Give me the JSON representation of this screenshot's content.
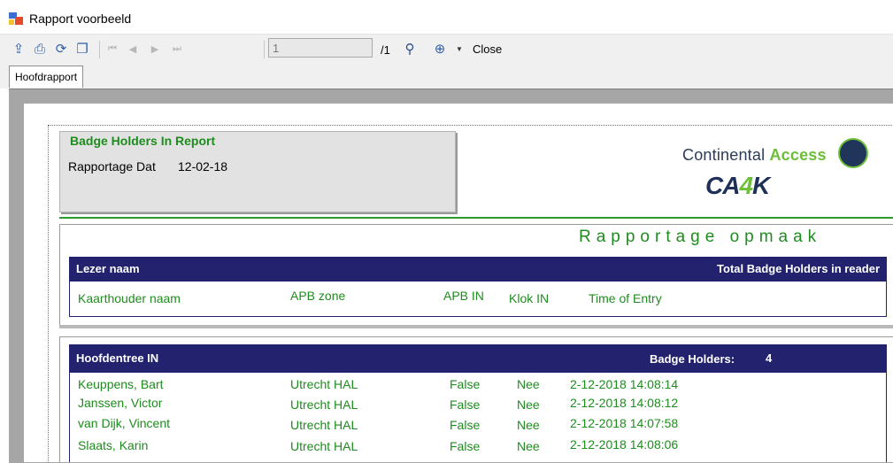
{
  "window": {
    "title": "Rapport voorbeeld"
  },
  "toolbar": {
    "export_icon": "export-icon",
    "print_icon": "print-icon",
    "refresh_icon": "refresh-icon",
    "copy_icon": "copy-icon",
    "first_icon": "first-page-icon",
    "prev_icon": "prev-page-icon",
    "next_icon": "next-page-icon",
    "last_icon": "last-page-icon",
    "page_value": "1",
    "page_total": "/1",
    "search_icon": "binoculars-icon",
    "zoom_icon": "zoom-icon",
    "close_label": "Close"
  },
  "tabs": [
    {
      "label": "Hoofdrapport"
    }
  ],
  "report": {
    "title": "Badge Holders In Report",
    "date_label": "Rapportage Dat",
    "date_value": "12-02-18",
    "logo_text": "Continental",
    "logo_accent": "Access",
    "logo_ca": "CA",
    "logo_4": "4",
    "logo_k": "K",
    "section_title": "Rapportage opmaak",
    "layout_header": {
      "left": "Lezer naam",
      "right": "Total Badge Holders in reader"
    },
    "layout_columns": [
      "Kaarthouder naam",
      "APB zone",
      "APB IN",
      "Klok IN",
      "Time of Entry"
    ],
    "group": {
      "name": "Hoofdentree IN",
      "count_label": "Badge Holders:",
      "count": "4",
      "rows": [
        {
          "name": "Keuppens, Bart",
          "zone": "Utrecht HAL",
          "apb_in": "False",
          "klok_in": "Nee",
          "time": "2-12-2018 14:08:14"
        },
        {
          "name": "Janssen, Victor",
          "zone": "Utrecht HAL",
          "apb_in": "False",
          "klok_in": "Nee",
          "time": "2-12-2018 14:08:12"
        },
        {
          "name": "van Dijk, Vincent",
          "zone": "Utrecht HAL",
          "apb_in": "False",
          "klok_in": "Nee",
          "time": "2-12-2018 14:07:58"
        },
        {
          "name": "Slaats, Karin",
          "zone": "Utrecht HAL",
          "apb_in": "False",
          "klok_in": "Nee",
          "time": "2-12-2018 14:08:06"
        }
      ]
    }
  },
  "colors": {
    "green": "#1e8c1e",
    "navy": "#22226e",
    "accent_green": "#6dbf3a"
  }
}
